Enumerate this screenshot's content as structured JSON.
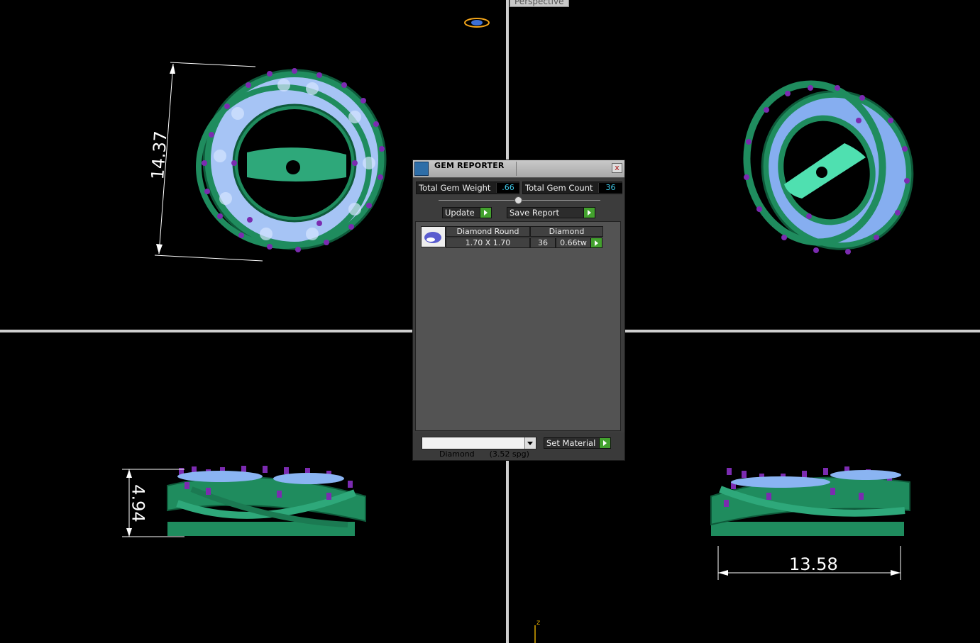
{
  "viewport": {
    "perspective_label": "Perspective"
  },
  "dimensions": {
    "top_left_height": "14.37",
    "bottom_left_height": "4.94",
    "bottom_right_width": "13.58"
  },
  "axis": {
    "z_label": "z"
  },
  "gem_reporter": {
    "title": "GEM REPORTER",
    "close": "x",
    "total_weight_label": "Total Gem Weight",
    "total_weight_value": ".66",
    "total_count_label": "Total Gem Count",
    "total_count_value": "36",
    "update_label": "Update",
    "save_report_label": "Save Report",
    "gem_row": {
      "shape_header": "Diamond Round",
      "material_header": "Diamond",
      "size": "1.70 X 1.70",
      "count": "36",
      "weight": "0.66tw"
    },
    "material_select": "Diamond      (3.52 spg)",
    "set_material_label": "Set Material"
  },
  "colors": {
    "metal": "#1f8c5e",
    "gem": "#8ab4f2",
    "prong": "#7b2bb0",
    "background": "#000000"
  }
}
